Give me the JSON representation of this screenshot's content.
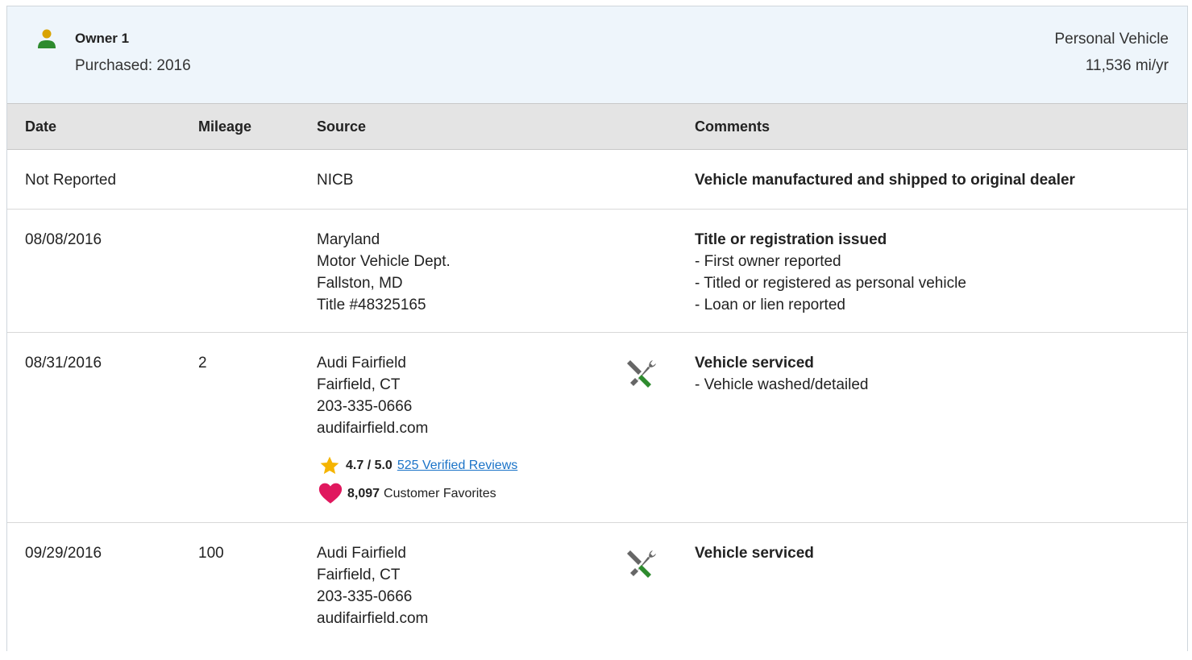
{
  "owner": {
    "name": "Owner 1",
    "purchased": "Purchased: 2016",
    "vehicle_type": "Personal Vehicle",
    "miles_per_year": "11,536 mi/yr",
    "icon": "person-icon"
  },
  "table": {
    "columns": [
      "Date",
      "Mileage",
      "Source",
      "Comments"
    ]
  },
  "rows": [
    {
      "date": "Not Reported",
      "mileage": "",
      "source": [
        "NICB"
      ],
      "comment_title": "Vehicle manufactured and shipped to original dealer",
      "comment_items": []
    },
    {
      "date": "08/08/2016",
      "mileage": "",
      "source": [
        "Maryland",
        "Motor Vehicle Dept.",
        "Fallston, MD",
        "Title #48325165"
      ],
      "comment_title": "Title or registration issued",
      "comment_items": [
        "- First owner reported",
        "- Titled or registered as personal vehicle",
        "- Loan or lien reported"
      ]
    },
    {
      "date": "08/31/2016",
      "mileage": "2",
      "source": [
        "Audi Fairfield",
        "Fairfield, CT",
        "203-335-0666",
        "audifairfield.com"
      ],
      "rating": "4.7 / 5.0",
      "reviews_link": "525 Verified Reviews",
      "favorites_count": "8,097",
      "favorites_label": "Customer Favorites",
      "comment_title": "Vehicle serviced",
      "comment_items": [
        "- Vehicle washed/detailed"
      ],
      "icon": "service-tools-icon"
    },
    {
      "date": "09/29/2016",
      "mileage": "100",
      "source": [
        "Audi Fairfield",
        "Fairfield, CT",
        "203-335-0666",
        "audifairfield.com"
      ],
      "comment_title": "Vehicle serviced",
      "comment_items": [],
      "icon": "service-tools-icon"
    }
  ],
  "colors": {
    "header_bg": "#eef5fb",
    "table_head_bg": "#e4e4e4",
    "link": "#1a73c8",
    "star": "#f5b400",
    "heart": "#e0185e",
    "icon_green": "#2e8b2e"
  }
}
